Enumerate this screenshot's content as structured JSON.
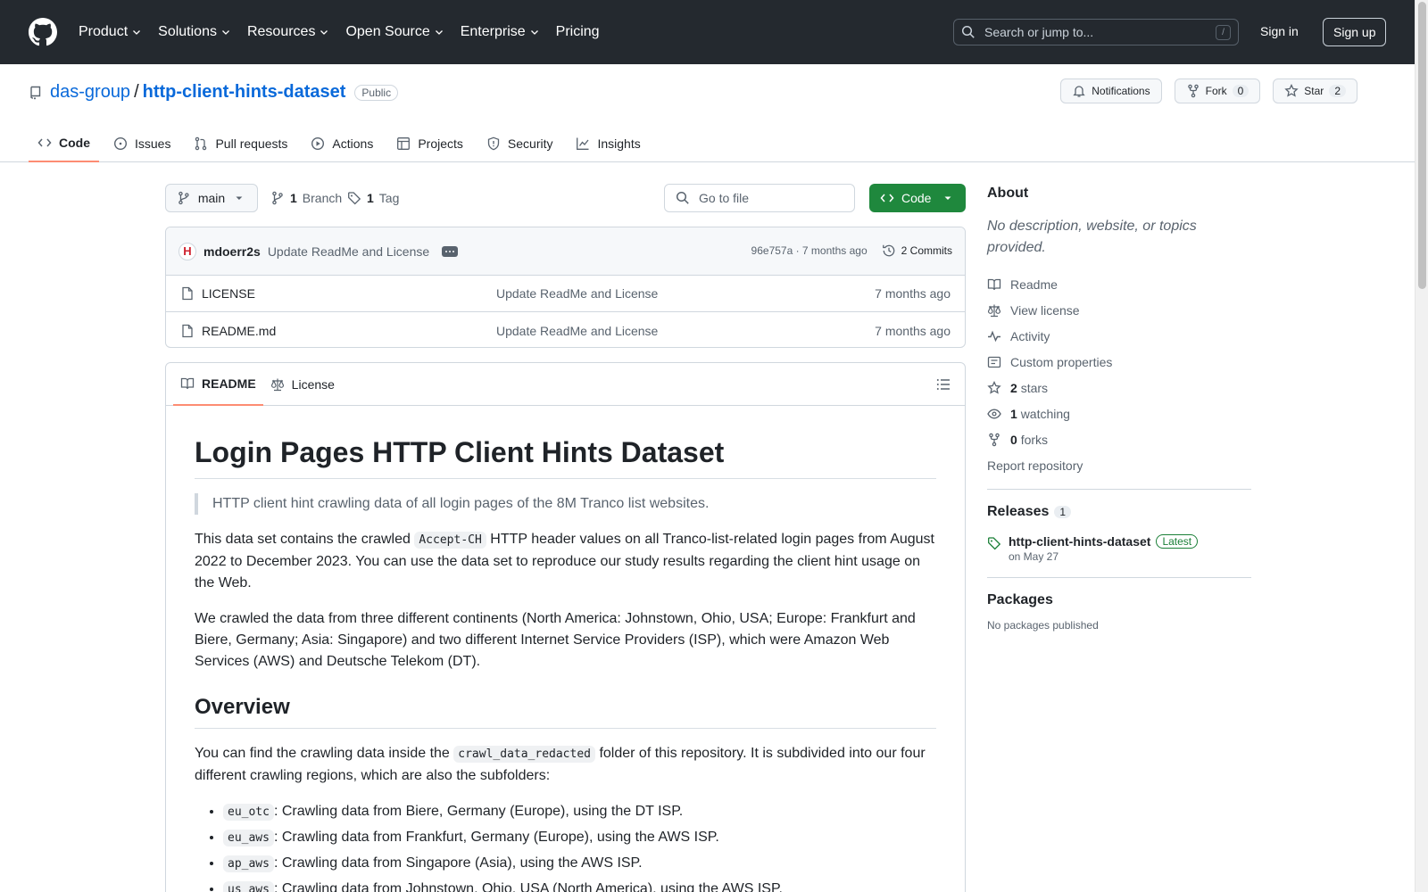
{
  "header": {
    "nav": [
      "Product",
      "Solutions",
      "Resources",
      "Open Source",
      "Enterprise",
      "Pricing"
    ],
    "search_placeholder": "Search or jump to...",
    "search_shortcut": "/",
    "signin": "Sign in",
    "signup": "Sign up"
  },
  "repo": {
    "owner": "das-group",
    "separator": "/",
    "name": "http-client-hints-dataset",
    "visibility": "Public",
    "notifications_label": "Notifications",
    "fork_label": "Fork",
    "fork_count": "0",
    "star_label": "Star",
    "star_count": "2"
  },
  "tabs": [
    {
      "label": "Code",
      "icon": "code-icon",
      "active": true
    },
    {
      "label": "Issues",
      "icon": "issue-icon"
    },
    {
      "label": "Pull requests",
      "icon": "pull-request-icon"
    },
    {
      "label": "Actions",
      "icon": "play-icon"
    },
    {
      "label": "Projects",
      "icon": "table-icon"
    },
    {
      "label": "Security",
      "icon": "shield-icon"
    },
    {
      "label": "Insights",
      "icon": "graph-icon"
    }
  ],
  "toolbar": {
    "branch": "main",
    "branch_count": "1",
    "branch_label": "Branch",
    "tag_count": "1",
    "tag_label": "Tag",
    "goto_placeholder": "Go to file",
    "code_label": "Code"
  },
  "latest_commit": {
    "avatar_letter": "H",
    "author": "mdoerr2s",
    "message": "Update ReadMe and License",
    "sha_time": "96e757a · 7 months ago",
    "commits_label": "2 Commits"
  },
  "files": [
    {
      "name": "LICENSE",
      "commit": "Update ReadMe and License",
      "time": "7 months ago"
    },
    {
      "name": "README.md",
      "commit": "Update ReadMe and License",
      "time": "7 months ago"
    }
  ],
  "readme": {
    "tab_readme": "README",
    "tab_license": "License",
    "title": "Login Pages HTTP Client Hints Dataset",
    "quote": "HTTP client hint crawling data of all login pages of the 8M Tranco list websites.",
    "p1_a": "This data set contains the crawled ",
    "p1_code": "Accept-CH",
    "p1_b": " HTTP header values on all Tranco-list-related login pages from August 2022 to December 2023. You can use the data set to reproduce our study results regarding the client hint usage on the Web.",
    "p2": "We crawled the data from three different continents (North America: Johnstown, Ohio, USA; Europe: Frankfurt and Biere, Germany; Asia: Singapore) and two different Internet Service Providers (ISP), which were Amazon Web Services (AWS) and Deutsche Telekom (DT).",
    "h2": "Overview",
    "p3_a": "You can find the crawling data inside the ",
    "p3_code": "crawl_data_redacted",
    "p3_b": " folder of this repository. It is subdivided into our four different crawling regions, which are also the subfolders:",
    "list": [
      {
        "code": "eu_otc",
        "text": ": Crawling data from Biere, Germany (Europe), using the DT ISP."
      },
      {
        "code": "eu_aws",
        "text": ": Crawling data from Frankfurt, Germany (Europe), using the AWS ISP."
      },
      {
        "code": "ap_aws",
        "text": ": Crawling data from Singapore (Asia), using the AWS ISP."
      },
      {
        "code": "us_aws",
        "text": ": Crawling data from Johnstown, Ohio, USA (North America), using the AWS ISP."
      }
    ]
  },
  "sidebar": {
    "about_title": "About",
    "about_desc": "No description, website, or topics provided.",
    "links": [
      {
        "icon": "book-icon",
        "label": "Readme"
      },
      {
        "icon": "law-icon",
        "label": "View license"
      },
      {
        "icon": "pulse-icon",
        "label": "Activity"
      },
      {
        "icon": "note-icon",
        "label": "Custom properties"
      }
    ],
    "stars_count": "2",
    "stars_label": "stars",
    "watching_count": "1",
    "watching_label": "watching",
    "forks_count": "0",
    "forks_label": "forks",
    "report": "Report repository",
    "releases_title": "Releases",
    "releases_count": "1",
    "release_name": "http-client-hints-dataset",
    "release_badge": "Latest",
    "release_date": "on May 27",
    "packages_title": "Packages",
    "packages_none": "No packages published"
  }
}
